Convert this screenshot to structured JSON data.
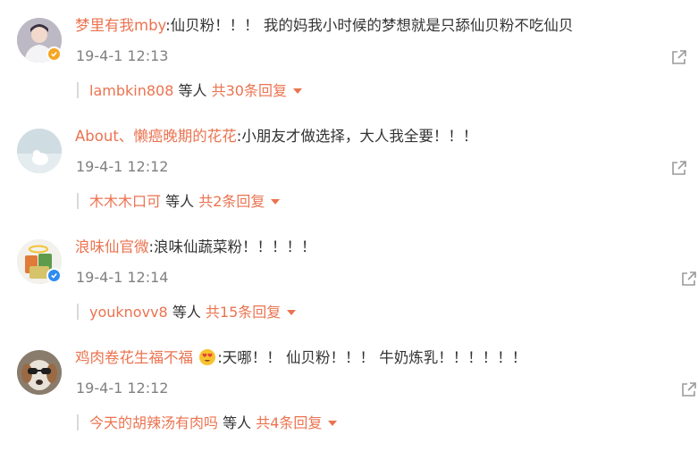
{
  "colors": {
    "accent": "#eb7350",
    "time": "#808080",
    "vip_gold": "#f5a623",
    "verified_blue": "#2d8cf0"
  },
  "comments": [
    {
      "username": "梦里有我mby",
      "text": ":仙贝粉！！！ 我的妈我小时候的梦想就是只舔仙贝粉不吃仙贝",
      "time": "19-4-1 12:13",
      "badge": "vip-gold-badge",
      "reply_users": "lambkin808",
      "reply_mid": "等人",
      "reply_total": "共30条回复"
    },
    {
      "username": "About、懒癌晚期的花花",
      "text": ":小朋友才做选择，大人我全要！！！",
      "time": "19-4-1 12:12",
      "badge": "",
      "reply_users": "木木木口可",
      "reply_mid": "等人",
      "reply_total": "共2条回复"
    },
    {
      "username": "浪味仙官微",
      "text": ":浪味仙蔬菜粉！！！！！",
      "time": "19-4-1 12:14",
      "badge": "verified-blue-badge",
      "reply_users": "youknovv8",
      "reply_mid": "等人",
      "reply_total": "共15条回复"
    },
    {
      "username": "鸡肉卷花生福不福",
      "emoji": "heart-eyes-emoji",
      "text": ":天哪！！ 仙贝粉！！！ 牛奶炼乳！！！！！！",
      "time": "19-4-1 12:12",
      "badge": "",
      "reply_users": "今天的胡辣汤有肉吗",
      "reply_mid": "等人",
      "reply_total": "共4条回复"
    }
  ]
}
